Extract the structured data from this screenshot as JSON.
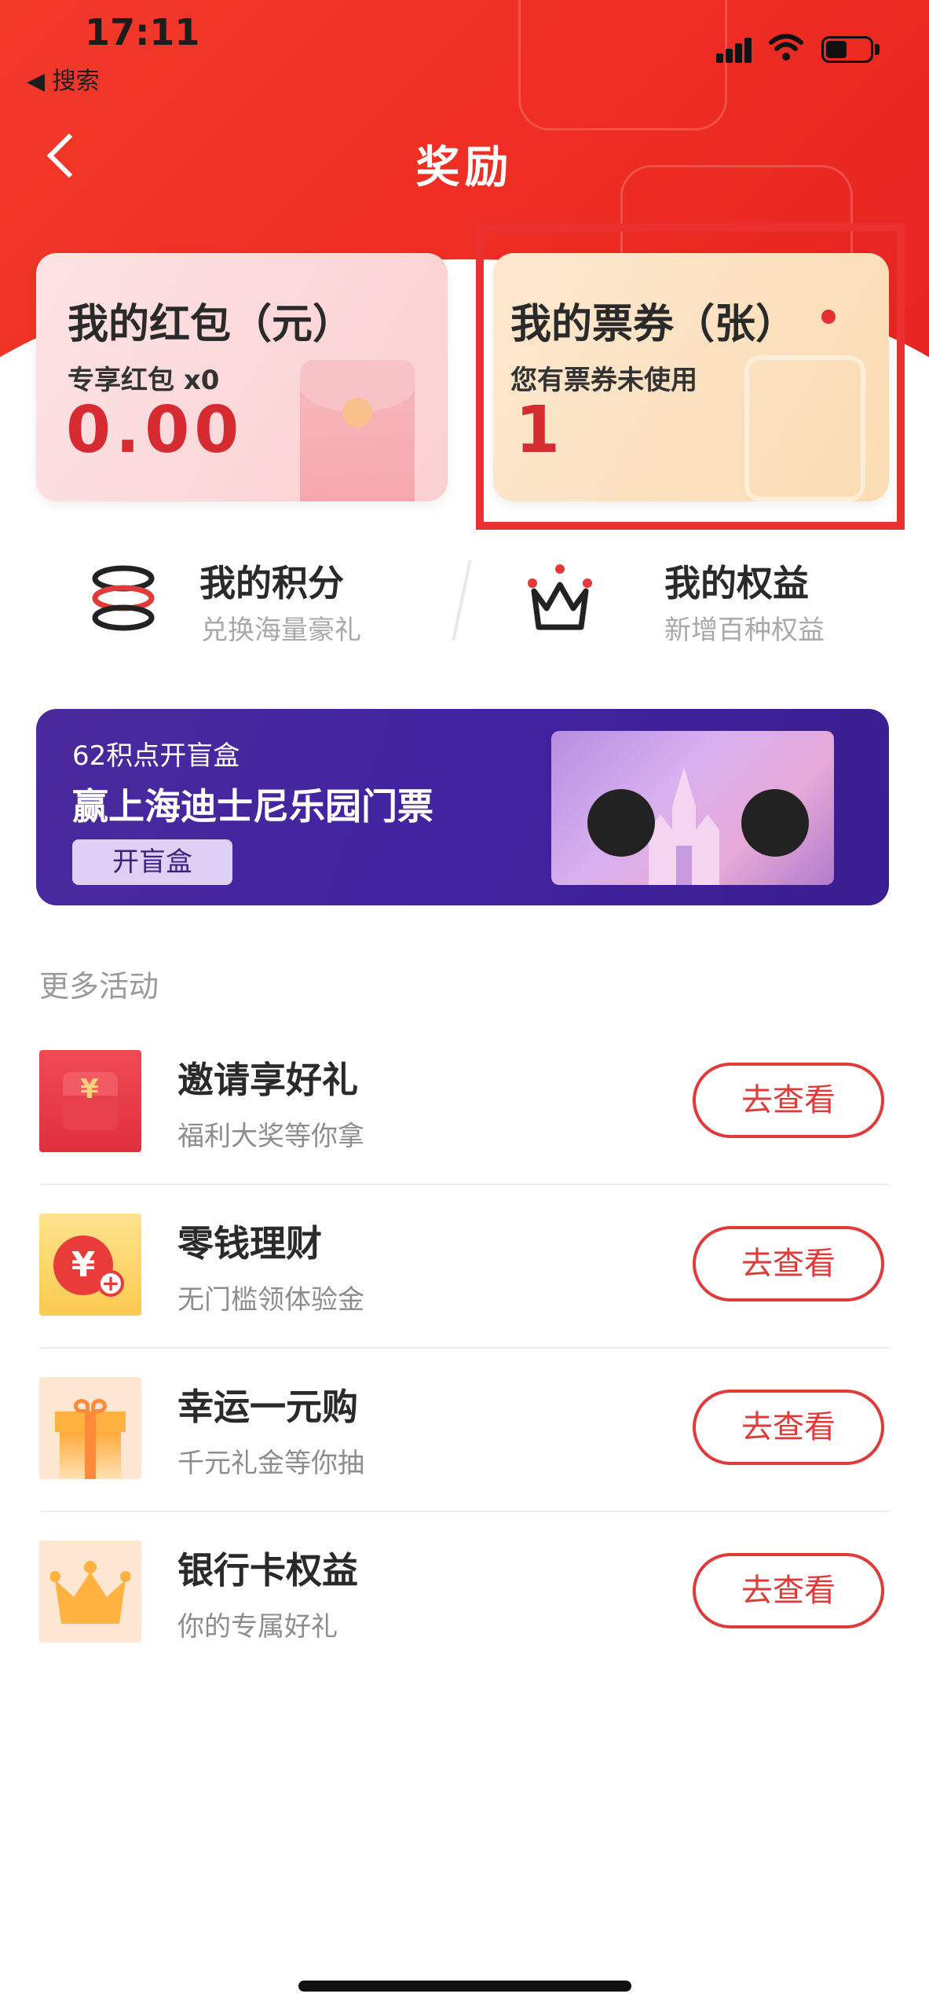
{
  "status_bar": {
    "time": "17:11",
    "back_app": "◀ 搜索"
  },
  "nav": {
    "title": "奖励"
  },
  "cards": {
    "red_packet": {
      "title": "我的红包（元）",
      "subtitle": "专享红包 x0",
      "value": "0.00"
    },
    "tickets": {
      "title": "我的票券（张）",
      "subtitle": "您有票券未使用",
      "value": "1"
    }
  },
  "quick": {
    "points": {
      "title": "我的积分",
      "subtitle": "兑换海量豪礼"
    },
    "benefits": {
      "title": "我的权益",
      "subtitle": "新增百种权益"
    }
  },
  "banner": {
    "small": "62积点开盲盒",
    "big": "赢上海迪士尼乐园门票",
    "button": "开盲盒"
  },
  "more": {
    "title": "更多活动",
    "items": [
      {
        "title": "邀请享好礼",
        "subtitle": "福利大奖等你拿",
        "button": "去查看",
        "icon": "red-envelope-icon"
      },
      {
        "title": "零钱理财",
        "subtitle": "无门槛领体验金",
        "button": "去查看",
        "icon": "yuan-coin-plus-icon"
      },
      {
        "title": "幸运一元购",
        "subtitle": "千元礼金等你抽",
        "button": "去查看",
        "icon": "gift-box-icon"
      },
      {
        "title": "银行卡权益",
        "subtitle": "你的专属好礼",
        "button": "去查看",
        "icon": "crown-icon"
      }
    ]
  },
  "colors": {
    "brand_red": "#e72421",
    "accent_red": "#e03a3a",
    "banner_purple": "#4123a0"
  }
}
